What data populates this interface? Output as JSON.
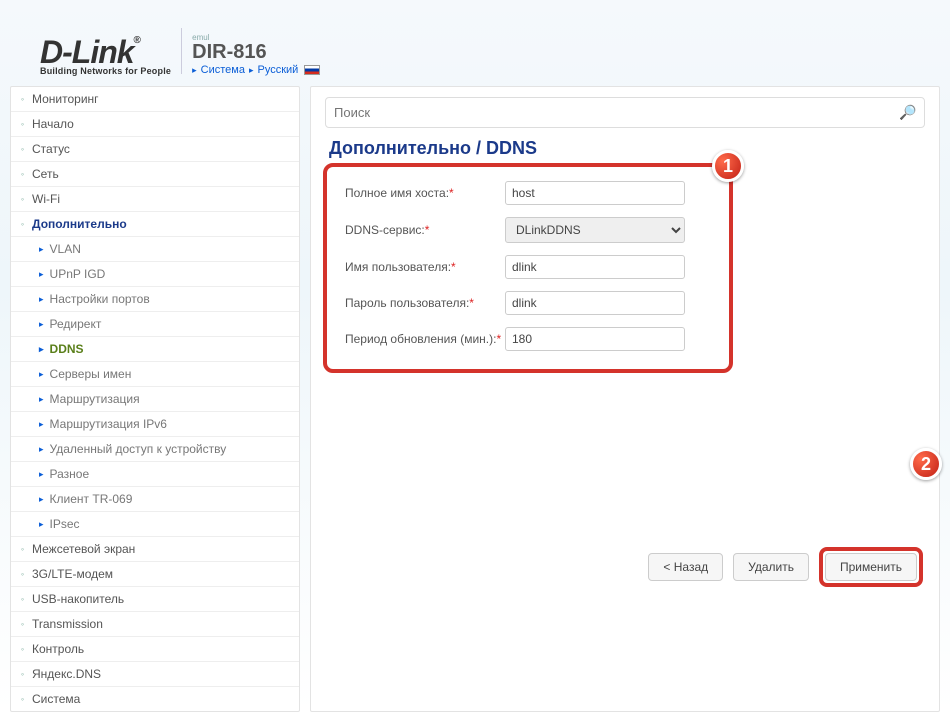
{
  "header": {
    "logo_main": "D-Link",
    "logo_sub": "Building Networks for People",
    "emul": "emul",
    "model": "DIR-816",
    "breadcrumb": {
      "system": "Система",
      "lang": "Русский"
    }
  },
  "sidebar": {
    "top": [
      {
        "label": "Мониторинг"
      },
      {
        "label": "Начало"
      },
      {
        "label": "Статус"
      },
      {
        "label": "Сеть"
      },
      {
        "label": "Wi-Fi"
      }
    ],
    "active_top": "Дополнительно",
    "subs": [
      {
        "label": "VLAN"
      },
      {
        "label": "UPnP IGD"
      },
      {
        "label": "Настройки портов"
      },
      {
        "label": "Редирект"
      },
      {
        "label": "DDNS",
        "active": true
      },
      {
        "label": "Серверы имен"
      },
      {
        "label": "Маршрутизация"
      },
      {
        "label": "Маршрутизация IPv6"
      },
      {
        "label": "Удаленный доступ к устройству"
      },
      {
        "label": "Разное"
      },
      {
        "label": "Клиент TR-069"
      },
      {
        "label": "IPsec"
      }
    ],
    "bottom": [
      {
        "label": "Межсетевой экран"
      },
      {
        "label": "3G/LTE-модем"
      },
      {
        "label": "USB-накопитель"
      },
      {
        "label": "Transmission"
      },
      {
        "label": "Контроль"
      },
      {
        "label": "Яндекс.DNS"
      },
      {
        "label": "Система"
      }
    ]
  },
  "main": {
    "search_placeholder": "Поиск",
    "title": "Дополнительно / DDNS",
    "form": {
      "hostname": {
        "label": "Полное имя хоста:",
        "value": "host"
      },
      "service": {
        "label": "DDNS-сервис:",
        "value": "DLinkDDNS"
      },
      "username": {
        "label": "Имя пользователя:",
        "value": "dlink"
      },
      "password": {
        "label": "Пароль пользователя:",
        "value": "dlink"
      },
      "period": {
        "label": "Период обновления (мин.):",
        "value": "180"
      }
    },
    "buttons": {
      "back": "< Назад",
      "delete": "Удалить",
      "apply": "Применить"
    },
    "markers": {
      "m1": "1",
      "m2": "2"
    }
  }
}
